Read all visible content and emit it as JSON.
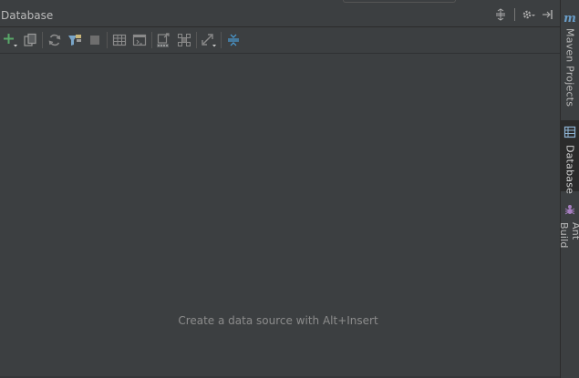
{
  "panel": {
    "title": "Database",
    "empty_message": "Create a data source with Alt+Insert"
  },
  "title_actions": [
    {
      "name": "collapse-all-icon"
    },
    {
      "name": "gear-icon"
    },
    {
      "name": "hide-panel-icon"
    }
  ],
  "toolbar": {
    "tools": [
      {
        "name": "add-icon",
        "color": "#59a869"
      },
      {
        "name": "copy-icon"
      },
      {
        "name": "refresh-icon"
      },
      {
        "name": "synchronize-icon"
      },
      {
        "name": "stop-icon"
      },
      {
        "name": "table-editor-icon"
      },
      {
        "name": "console-icon"
      },
      {
        "name": "ddl-icon"
      },
      {
        "name": "diagram-icon"
      },
      {
        "name": "expand-icon"
      },
      {
        "name": "collapse-icon",
        "color": "#4a9fd8"
      }
    ]
  },
  "side_strip": {
    "items": [
      {
        "label": "Maven Projects",
        "icon": "maven-icon",
        "active": false
      },
      {
        "label": "Database",
        "icon": "database-icon",
        "active": true
      },
      {
        "label": "Ant Build",
        "icon": "ant-icon",
        "active": false
      }
    ]
  },
  "colors": {
    "background": "#3c3f41",
    "text": "#bbbbbb",
    "muted_text": "#8c8c8c",
    "accent_green": "#59a869",
    "accent_blue": "#4a9fd8"
  }
}
